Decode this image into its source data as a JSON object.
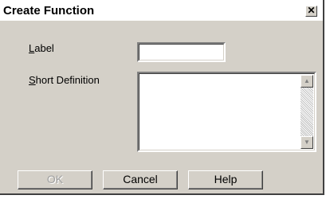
{
  "dialog": {
    "title": "Create Function",
    "close_glyph": "✕"
  },
  "form": {
    "label_text": "Label",
    "label_accesskey": "L",
    "label_rest": "abel",
    "label_value": "",
    "short_def_accesskey": "S",
    "short_def_rest": "hort Definition",
    "short_def_value": ""
  },
  "scrollbar": {
    "up_icon": "▲",
    "down_icon": "▼"
  },
  "buttons": {
    "ok": "OK",
    "cancel": "Cancel",
    "help": "Help"
  }
}
